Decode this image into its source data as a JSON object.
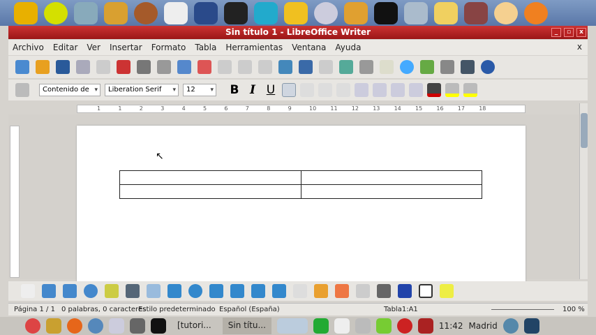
{
  "window": {
    "title": "Sin título 1 - LibreOffice Writer",
    "min": "_",
    "max": "▫",
    "close": "x"
  },
  "menu": [
    "Archivo",
    "Editar",
    "Ver",
    "Insertar",
    "Formato",
    "Tabla",
    "Herramientas",
    "Ventana",
    "Ayuda"
  ],
  "menu_close": "x",
  "formatting": {
    "style": "Contenido de",
    "font": "Liberation Serif",
    "size": "12",
    "bold": "B",
    "italic": "I",
    "underline": "U"
  },
  "ruler": [
    "1",
    "1",
    "2",
    "3",
    "4",
    "5",
    "6",
    "7",
    "8",
    "9",
    "10",
    "11",
    "12",
    "13",
    "14",
    "15",
    "16",
    "17",
    "18"
  ],
  "status": {
    "page": "Página 1 / 1",
    "words": "0 palabras, 0 caracteres",
    "style": "Estilo predeterminado",
    "language": "Español (España)",
    "cell": "Tabla1:A1",
    "zoom": "100 %"
  },
  "taskbar": {
    "tasks": [
      "[tutori...",
      "Sin títu..."
    ],
    "clock": "11:42",
    "location": "Madrid"
  },
  "colors": {
    "titlebar": "#b11d1d",
    "launcher": "#6e8ab8"
  }
}
